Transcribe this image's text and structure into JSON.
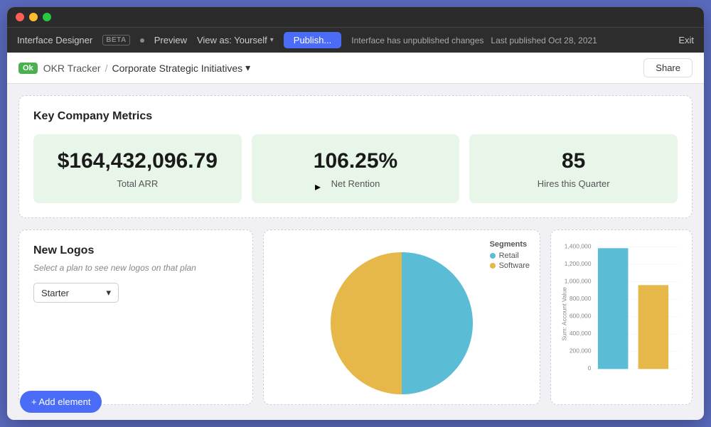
{
  "window": {
    "title": "Interface Designer"
  },
  "toolbar": {
    "app_name": "Interface Designer",
    "beta_badge": "BETA",
    "preview_label": "Preview",
    "view_as_label": "View as: Yourself",
    "publish_label": "Publish...",
    "status_text": "Interface has unpublished changes",
    "last_published": "Last published Oct 28, 2021",
    "exit_label": "Exit"
  },
  "nav": {
    "ok_badge": "Ok",
    "breadcrumb_root": "OKR Tracker",
    "breadcrumb_current": "Corporate Strategic Initiatives",
    "share_label": "Share"
  },
  "metrics_card": {
    "title": "Key Company Metrics",
    "metrics": [
      {
        "value": "$164,432,096.79",
        "label": "Total ARR"
      },
      {
        "value": "106.25%",
        "label": "Net Rention"
      },
      {
        "value": "85",
        "label": "Hires this Quarter"
      }
    ]
  },
  "new_logos_card": {
    "title": "New Logos",
    "subtitle": "Select a plan to see new logos on that plan",
    "dropdown_value": "Starter",
    "dropdown_chevron": "▾"
  },
  "chart_legend": {
    "title": "Segments",
    "items": [
      {
        "label": "Retail",
        "color": "#5bbcd6"
      },
      {
        "label": "Software",
        "color": "#e6b84a"
      }
    ]
  },
  "bar_chart": {
    "y_labels": [
      "1,400,000",
      "1,200,000",
      "1,000,000",
      "800,000",
      "600,000",
      "400,000",
      "200,000",
      "0"
    ],
    "y_axis_label": "Sum: Account Value",
    "bars": [
      {
        "color": "#5bbcd6",
        "height_pct": 93
      },
      {
        "color": "#e6b84a",
        "height_pct": 65
      }
    ]
  },
  "add_element_btn": "+ Add element"
}
